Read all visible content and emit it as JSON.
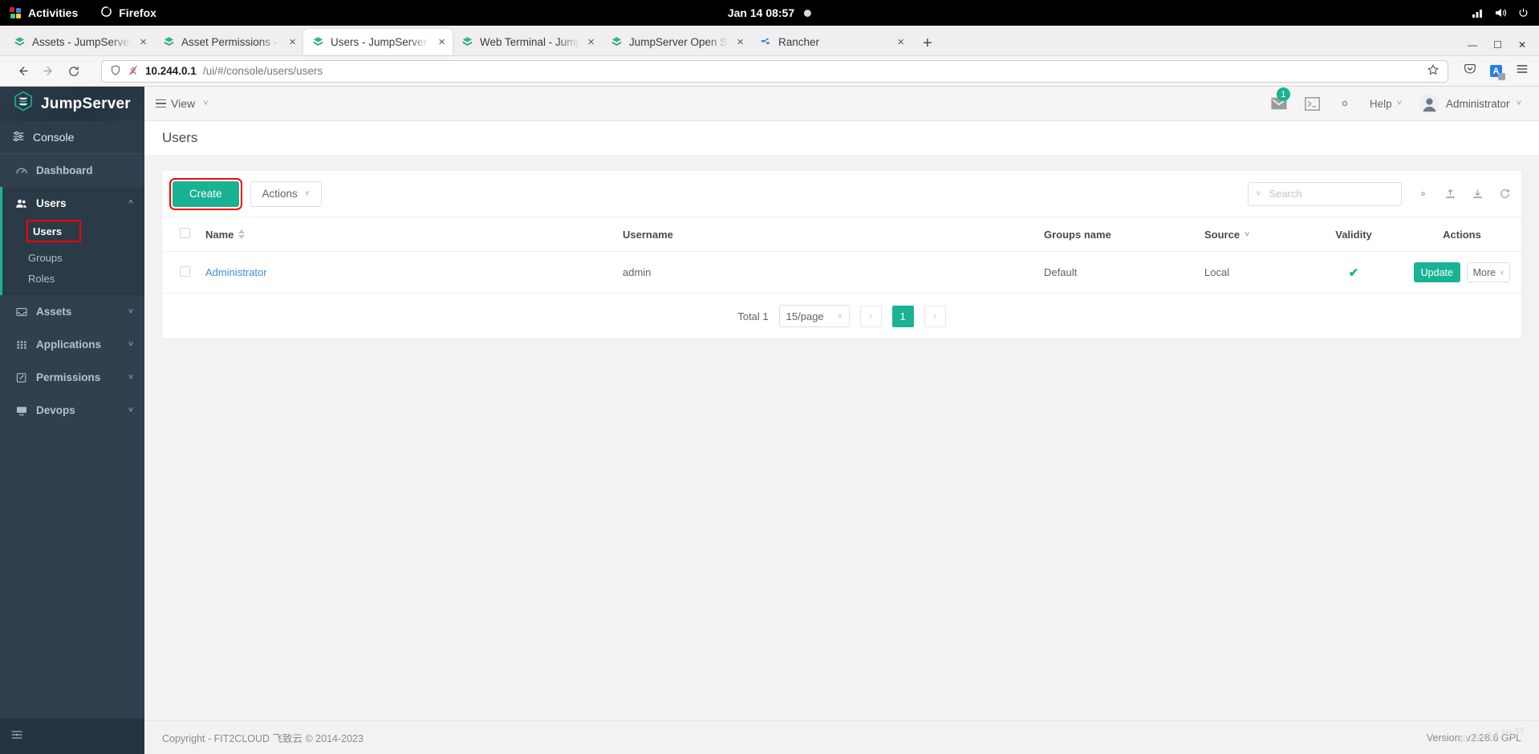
{
  "os_bar": {
    "activities_label": "Activities",
    "app_label": "Firefox",
    "clock": "Jan 14  08:57",
    "indicators": [
      "network-icon",
      "volume-icon",
      "power-icon"
    ]
  },
  "browser": {
    "tabs": [
      {
        "title": "Assets - JumpServer Open",
        "icon": "jumpserver-icon",
        "active": false
      },
      {
        "title": "Asset Permissions - Jump",
        "icon": "jumpserver-icon",
        "active": false
      },
      {
        "title": "Users - JumpServer Open",
        "icon": "jumpserver-icon",
        "active": true
      },
      {
        "title": "Web Terminal - JumpServ",
        "icon": "jumpserver-icon",
        "active": false
      },
      {
        "title": "JumpServer Open Source",
        "icon": "jumpserver-icon",
        "active": false
      },
      {
        "title": "Rancher",
        "icon": "rancher-icon",
        "active": false
      }
    ],
    "new_tab_label": "+",
    "close_label": "×",
    "window_controls": {
      "minimize": "—",
      "maximize": "☐",
      "close": "✕"
    },
    "url": {
      "host": "10.244.0.1",
      "path": "/ui/#/console/users/users"
    },
    "nav": {
      "back": "back-icon",
      "forward": "forward-icon",
      "reload": "reload-icon"
    },
    "right_icons": [
      "pocket-icon",
      "account-icon",
      "menu-icon"
    ],
    "bookmark_icon": "star-icon"
  },
  "sidebar": {
    "brand": "JumpServer",
    "console_label": "Console",
    "items": [
      {
        "label": "Dashboard",
        "icon": "dashboard-icon",
        "expandable": false,
        "open": false
      },
      {
        "label": "Users",
        "icon": "users-icon",
        "expandable": true,
        "open": true
      },
      {
        "label": "Assets",
        "icon": "assets-icon",
        "expandable": true,
        "open": false
      },
      {
        "label": "Applications",
        "icon": "applications-icon",
        "expandable": true,
        "open": false
      },
      {
        "label": "Permissions",
        "icon": "permissions-icon",
        "expandable": true,
        "open": false
      },
      {
        "label": "Devops",
        "icon": "devops-icon",
        "expandable": true,
        "open": false
      }
    ],
    "sub_items": [
      {
        "label": "Users",
        "current": true,
        "highlighted": true
      },
      {
        "label": "Groups",
        "current": false,
        "highlighted": false
      },
      {
        "label": "Roles",
        "current": false,
        "highlighted": false
      }
    ],
    "collapse_icon": "collapse-icon",
    "accent_color": "#19b394"
  },
  "topbar": {
    "view_label": "View",
    "help_label": "Help",
    "user_label": "Administrator",
    "message_badge": "1",
    "icons": [
      "mail-icon",
      "terminal-icon",
      "gear-icon"
    ]
  },
  "page": {
    "title": "Users"
  },
  "toolbar": {
    "create_label": "Create",
    "actions_label": "Actions",
    "search_placeholder": "Search",
    "search_value": "",
    "right_icons": [
      "column-settings-icon",
      "import-icon",
      "export-icon",
      "refresh-icon"
    ],
    "create_highlight_color": "#ff0000"
  },
  "table": {
    "columns": [
      {
        "label": "Name",
        "sortable": true
      },
      {
        "label": "Username",
        "sortable": false
      },
      {
        "label": "Groups name",
        "sortable": false
      },
      {
        "label": "Source",
        "sortable": true
      },
      {
        "label": "Validity",
        "sortable": false
      },
      {
        "label": "Actions",
        "sortable": false
      }
    ],
    "rows": [
      {
        "name": "Administrator",
        "username": "admin",
        "groups_name": "Default",
        "source": "Local",
        "validity": "✔",
        "update_label": "Update",
        "more_label": "More"
      }
    ]
  },
  "pagination": {
    "total_label": "Total 1",
    "page_size": "15/page",
    "prev_label": "‹",
    "next_label": "›",
    "pages": [
      "1"
    ],
    "current_page": "1"
  },
  "footer": {
    "copyright": "Copyright - FIT2CLOUD 飞致云 © 2014-2023",
    "version": "Version: v2.28.6 GPL",
    "watermark": "10.244.0.1 09:33"
  }
}
